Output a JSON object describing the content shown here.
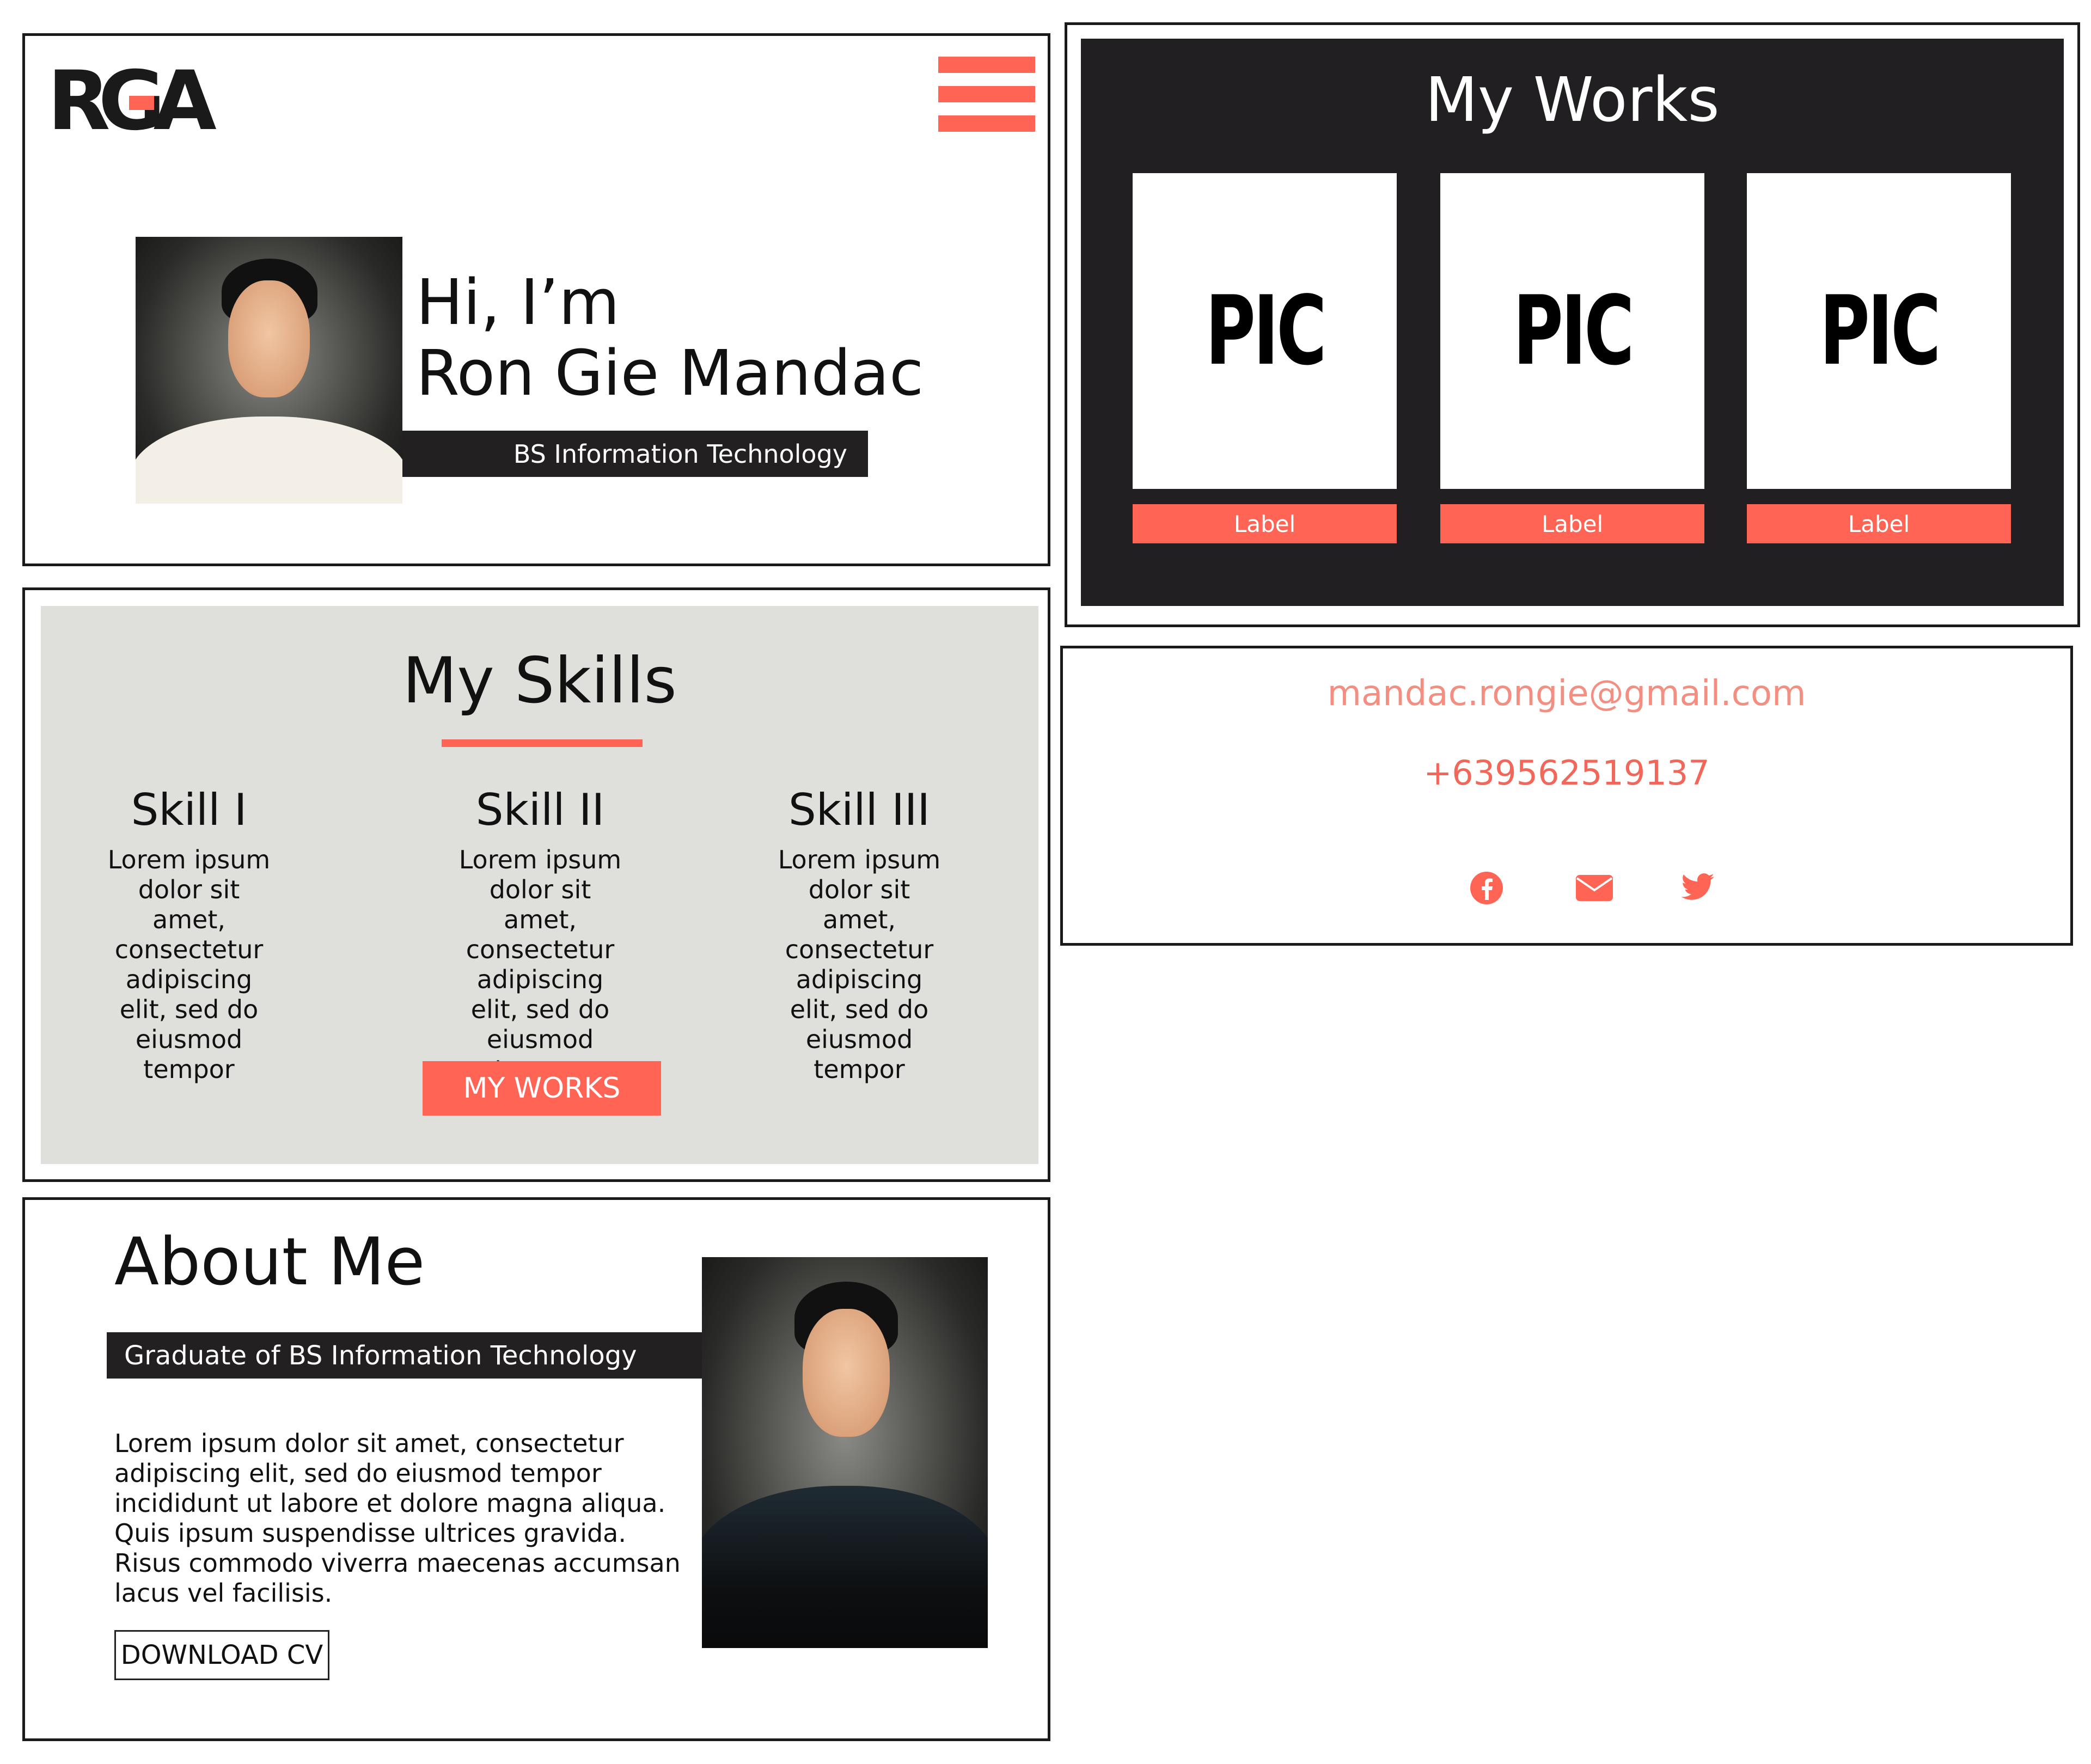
{
  "colors": {
    "accent": "#ff6454",
    "dark": "#232022",
    "works_bg": "#221f22",
    "skills_bg": "#dfe0db",
    "email": "#f38e81"
  },
  "hero": {
    "logo": "RGA",
    "greeting_line1": "Hi, I’m",
    "greeting_line2": "Ron Gie Mandac",
    "subtitle": "BS Information Technology"
  },
  "works": {
    "title": "My Works",
    "items": [
      {
        "pic": "PIC",
        "label": "Label"
      },
      {
        "pic": "PIC",
        "label": "Label"
      },
      {
        "pic": "PIC",
        "label": "Label"
      }
    ]
  },
  "skills": {
    "title": "My Skills",
    "items": [
      {
        "name": "Skill I",
        "desc": "Lorem ipsum dolor sit amet, consectetur adipiscing elit, sed do eiusmod tempor"
      },
      {
        "name": "Skill II",
        "desc": "Lorem ipsum dolor sit amet, consectetur adipiscing elit, sed do eiusmod tempor"
      },
      {
        "name": "Skill III",
        "desc": "Lorem ipsum dolor sit amet, consectetur adipiscing elit, sed do eiusmod tempor"
      }
    ],
    "button": "MY WORKS"
  },
  "contact": {
    "email": "mandac.rongie@gmail.com",
    "phone": "+639562519137",
    "icons": [
      "facebook-icon",
      "mail-icon",
      "twitter-icon"
    ]
  },
  "about": {
    "title": "About Me",
    "subtitle": "Graduate of BS Information Technology",
    "text": "Lorem ipsum dolor sit amet, consectetur adipiscing elit, sed do eiusmod tempor incididunt ut labore et dolore magna aliqua. Quis ipsum suspendisse ultrices gravida. Risus commodo viverra maecenas accumsan lacus vel facilisis.",
    "button": "DOWNLOAD CV"
  }
}
